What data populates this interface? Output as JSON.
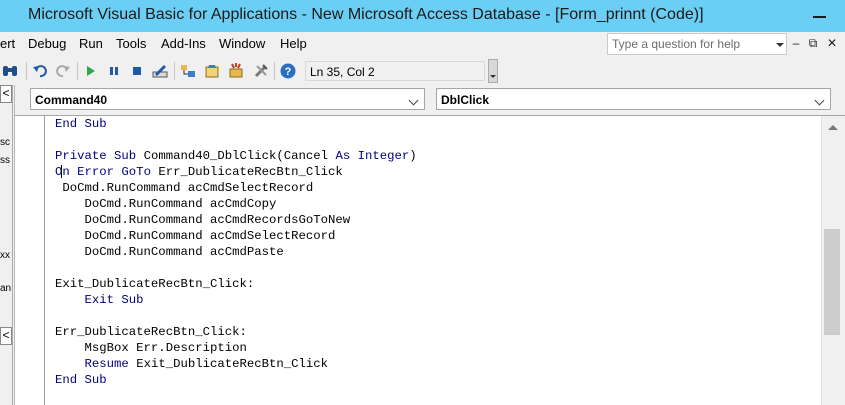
{
  "window": {
    "title": "Microsoft Visual Basic for Applications - New Microsoft Access Database - [Form_prinnt (Code)]"
  },
  "menu": {
    "items": [
      "ert",
      "Debug",
      "Run",
      "Tools",
      "Add-Ins",
      "Window",
      "Help"
    ]
  },
  "help_search": {
    "placeholder": "Type a question for help"
  },
  "mdi_controls": {
    "minimize": "–",
    "restore": "⧉",
    "close": "✕"
  },
  "toolbar": {
    "position": "Ln 35, Col 2",
    "icons": [
      "binoculars-icon",
      "undo-icon",
      "redo-icon",
      "run-icon",
      "break-icon",
      "reset-icon",
      "design-mode-icon",
      "project-explorer-icon",
      "properties-icon",
      "object-browser-icon",
      "toolbox-icon",
      "help-icon"
    ]
  },
  "left_panel": {
    "btn_1": "<",
    "text_1": "sc",
    "text_2": "ss",
    "text_3": "xx",
    "text_4": "an",
    "btn_2": "<"
  },
  "code_window": {
    "object_combo": "Command40",
    "procedure_combo": "DblClick"
  },
  "code_lines": [
    {
      "text": "End Sub",
      "kw": true
    },
    {
      "text": "",
      "kw": false
    },
    {
      "text": "Private Sub Command40_DblClick(Cancel As Integer)",
      "kw": false
    },
    {
      "text": "On Error GoTo Err_DublicateRecBtn_Click",
      "kw": false
    },
    {
      "text": " DoCmd.RunCommand acCmdSelectRecord",
      "kw": false
    },
    {
      "text": "    DoCmd.RunCommand acCmdCopy",
      "kw": false
    },
    {
      "text": "    DoCmd.RunCommand acCmdRecordsGoToNew",
      "kw": false
    },
    {
      "text": "    DoCmd.RunCommand acCmdSelectRecord",
      "kw": false
    },
    {
      "text": "    DoCmd.RunCommand acCmdPaste",
      "kw": false
    },
    {
      "text": "",
      "kw": false
    },
    {
      "text": "Exit_DublicateRecBtn_Click:",
      "kw": false
    },
    {
      "text": "    Exit Sub",
      "kw": true
    },
    {
      "text": "",
      "kw": false
    },
    {
      "text": "Err_DublicateRecBtn_Click:",
      "kw": false
    },
    {
      "text": "    MsgBox Err.Description",
      "kw": false
    },
    {
      "text": "    Resume Exit_DublicateRecBtn_Click",
      "kw": false
    },
    {
      "text": "End Sub",
      "kw": true
    }
  ]
}
